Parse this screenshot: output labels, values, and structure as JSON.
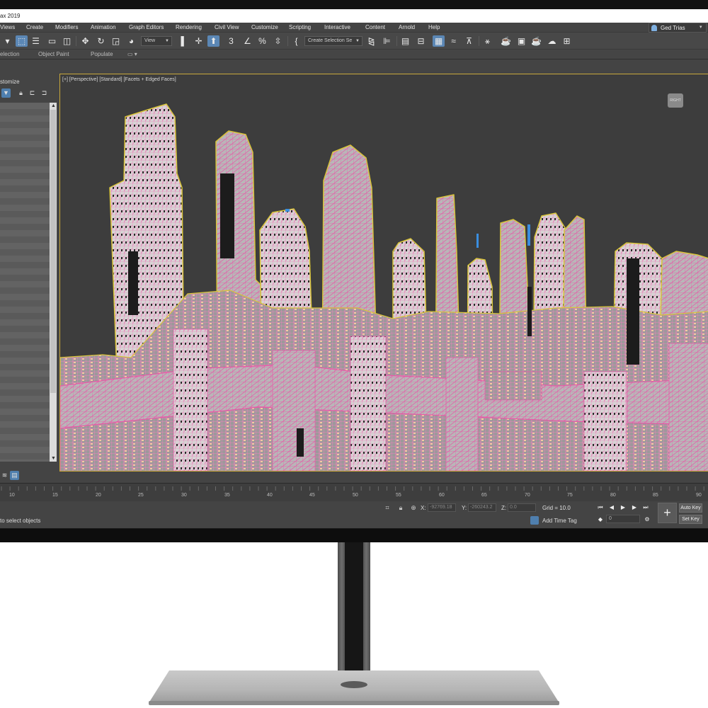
{
  "window": {
    "title": "ax 2019"
  },
  "menu": [
    "Views",
    "Create",
    "Modifiers",
    "Animation",
    "Graph Editors",
    "Rendering",
    "Civil View",
    "Customize",
    "Scripting",
    "Interactive",
    "Content",
    "Arnold",
    "Help"
  ],
  "user": {
    "name": "Ged Trias"
  },
  "toolbar": {
    "view_dropdown": "View",
    "selection_set_dropdown": "Create Selection Se",
    "snap_label": "3",
    "percent_label": "%"
  },
  "ribbon": {
    "tabs": [
      "election",
      "Object Paint",
      "Populate"
    ]
  },
  "panel": {
    "title": "stomize"
  },
  "viewport": {
    "label": "[+] [Perspective] [Standard] [Facets + Edged Faces]",
    "cube_label": "RIGHT"
  },
  "timeline": {
    "ticks": [
      "10",
      "15",
      "20",
      "25",
      "30",
      "35",
      "40",
      "45",
      "50",
      "55",
      "60",
      "65",
      "70",
      "75",
      "80",
      "85",
      "90"
    ]
  },
  "status": {
    "prompt": "to select objects",
    "x_label": "X:",
    "x_value": "-92769.18",
    "y_label": "Y:",
    "y_value": "-260243.2",
    "z_label": "Z:",
    "z_value": "0.0",
    "grid": "Grid = 10.0",
    "add_time_tag": "Add Time Tag",
    "frame": "0",
    "auto_key": "Auto Key",
    "set_key": "Set Key"
  },
  "colors": {
    "ui_dark": "#444444",
    "viewport_bg": "#3d3d3d",
    "selection_outline": "#d8c43a",
    "wireframe_pink": "#e85aa8",
    "accent_blue": "#4f7fae"
  }
}
